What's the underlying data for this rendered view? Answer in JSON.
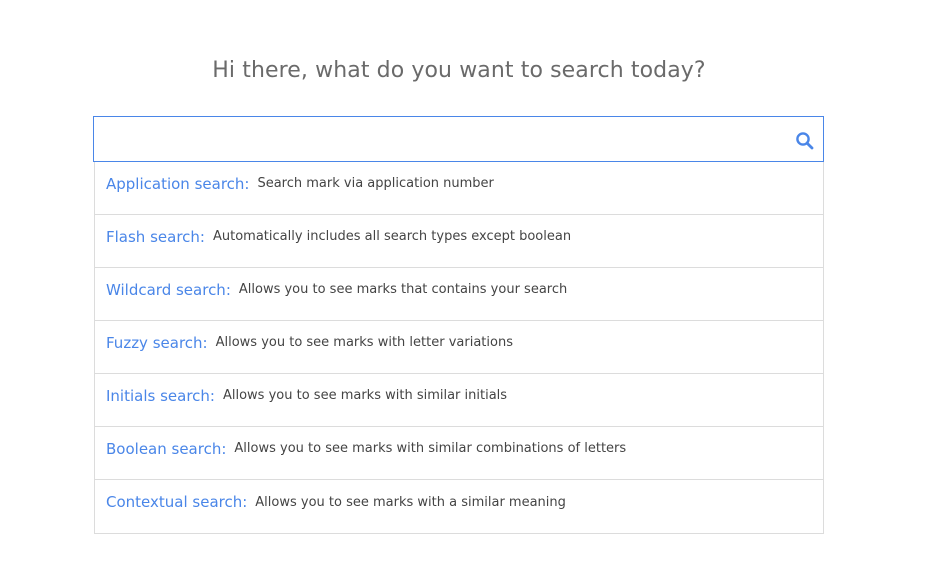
{
  "heading": "Hi there, what do you want to search today?",
  "search": {
    "value": "",
    "placeholder": "",
    "icon": "search-icon",
    "accent_color": "#4a86e8"
  },
  "options": [
    {
      "name": "Application search:",
      "description": "Search mark via application number"
    },
    {
      "name": "Flash search:",
      "description": "Automatically includes all search types except boolean"
    },
    {
      "name": "Wildcard search:",
      "description": "Allows you to see marks that contains your search"
    },
    {
      "name": "Fuzzy search:",
      "description": "Allows you to see marks with letter variations"
    },
    {
      "name": "Initials search:",
      "description": "Allows you to see marks with similar initials"
    },
    {
      "name": "Boolean search:",
      "description": "Allows you to see marks with similar combinations of letters"
    },
    {
      "name": "Contextual search:",
      "description": "Allows you to see marks with a similar meaning"
    }
  ]
}
